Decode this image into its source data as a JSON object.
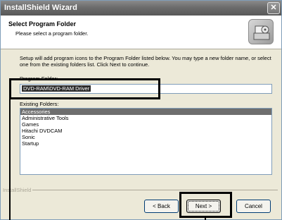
{
  "window": {
    "title": "InstallShield Wizard",
    "close_glyph": "✕"
  },
  "header": {
    "title": "Select Program Folder",
    "subtitle": "Please select a program folder.",
    "icon": "installer-box-icon"
  },
  "instructions": "Setup will add program icons to the Program Folder listed below.  You may type a new folder name, or select one from the existing folders list. Click Next to continue.",
  "program_folder": {
    "label": "Program Folder:",
    "value": "DVD-RAM\\DVD-RAM Driver"
  },
  "existing_folders": {
    "label": "Existing Folders:",
    "items": [
      "Accessories",
      "Administrative Tools",
      "Games",
      "Hitachi DVDCAM",
      "Sonic",
      "Startup"
    ],
    "selected_index": 0
  },
  "footer": {
    "group_label": "InstallShield"
  },
  "buttons": {
    "back": "< Back",
    "next": "Next >",
    "cancel": "Cancel"
  }
}
